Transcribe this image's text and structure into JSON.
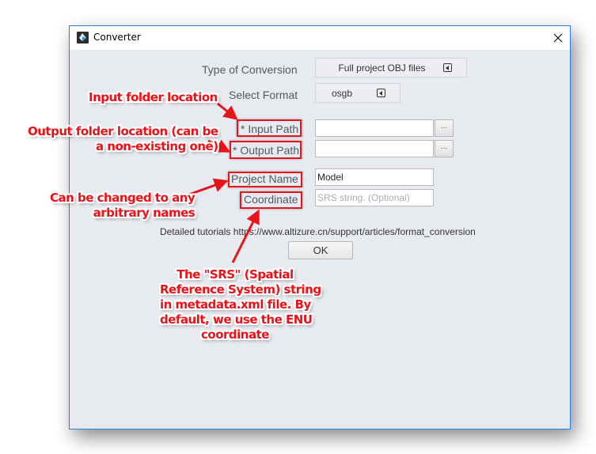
{
  "window": {
    "title": "Converter",
    "accent_color": "#2b7fd4"
  },
  "form": {
    "conversion_type": {
      "label": "Type of Conversion",
      "value": "Full project OBJ files"
    },
    "format": {
      "label": "Select Format",
      "value": "osgb"
    },
    "input_path": {
      "label": "* Input Path",
      "value": "",
      "browse_label": "..."
    },
    "output_path": {
      "label": "* Output Path",
      "value": "",
      "browse_label": "..."
    },
    "project_name": {
      "label": "Project Name",
      "value": "Model"
    },
    "coordinate": {
      "label": "Coordinate",
      "value": "",
      "placeholder": "SRS string. (Optional)"
    },
    "tutorial_text": "Detailed tutorials https://www.altizure.cn/support/articles/format_conversion",
    "ok_label": "OK"
  },
  "annotations": {
    "color": "#e8141c",
    "input_folder": "Input folder location",
    "output_folder": [
      "Output folder location (can be",
      "a non-existing one)"
    ],
    "project_name": [
      "Can be changed to any",
      "arbitrary names"
    ],
    "coordinate": [
      "The \"SRS\" (Spatial",
      "Reference System) string",
      "in metadata.xml file. By",
      "default, we use the ENU",
      "coordinate"
    ]
  }
}
